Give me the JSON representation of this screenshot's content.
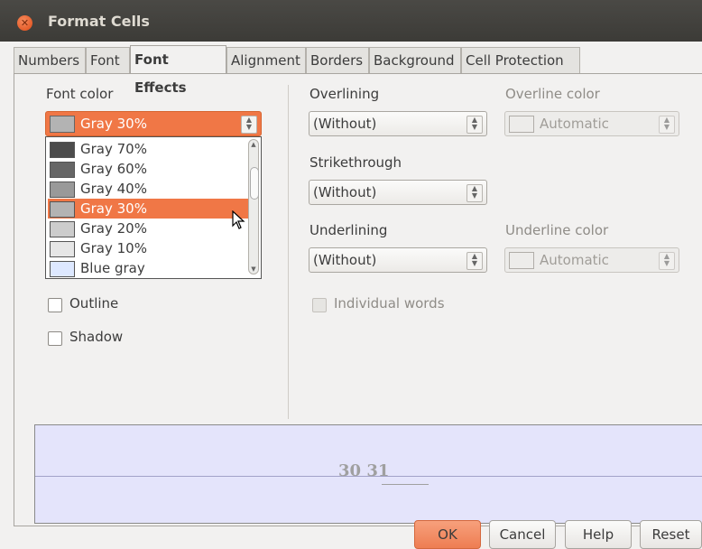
{
  "window": {
    "title": "Format Cells"
  },
  "tabs": [
    {
      "label": "Numbers"
    },
    {
      "label": "Font"
    },
    {
      "label": "Font Effects",
      "active": true
    },
    {
      "label": "Alignment"
    },
    {
      "label": "Borders"
    },
    {
      "label": "Background"
    },
    {
      "label": "Cell Protection"
    }
  ],
  "font_color": {
    "label": "Font color",
    "selected": "Gray 30%",
    "options": [
      {
        "label": "Gray 70%",
        "color": "#4c4c4c"
      },
      {
        "label": "Gray 60%",
        "color": "#666666"
      },
      {
        "label": "Gray 40%",
        "color": "#999999"
      },
      {
        "label": "Gray 30%",
        "color": "#b3b3b3",
        "selected": true
      },
      {
        "label": "Gray 20%",
        "color": "#cccccc"
      },
      {
        "label": "Gray 10%",
        "color": "#e6e6e6"
      },
      {
        "label": "Blue gray",
        "color": "#dde8ff"
      }
    ]
  },
  "overlining": {
    "label": "Overlining",
    "value": "(Without)",
    "color_label": "Overline color",
    "color_value": "Automatic"
  },
  "strikethrough": {
    "label": "Strikethrough",
    "value": "(Without)"
  },
  "underlining": {
    "label": "Underlining",
    "value": "(Without)",
    "color_label": "Underline color",
    "color_value": "Automatic"
  },
  "checkboxes": {
    "outline": "Outline",
    "shadow": "Shadow",
    "individual_words": "Individual words"
  },
  "preview": {
    "sample_text": "30 31"
  },
  "buttons": {
    "ok": "OK",
    "cancel": "Cancel",
    "help": "Help",
    "reset": "Reset"
  },
  "colors": {
    "accent": "#f07746",
    "preview_bg": "#e4e4fb"
  }
}
